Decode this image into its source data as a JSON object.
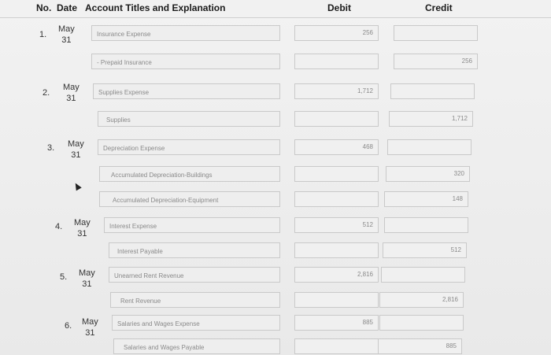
{
  "header": {
    "no": "No.",
    "date": "Date",
    "account": "Account Titles and Explanation",
    "debit": "Debit",
    "credit": "Credit"
  },
  "entries": [
    {
      "no": "1.",
      "month": "May",
      "day": "31",
      "debit_account": "Insurance Expense",
      "credit_account": "Prepaid Insurance",
      "debit_amount": "256",
      "credit_amount": "256"
    },
    {
      "no": "2.",
      "month": "May",
      "day": "31",
      "debit_account": "Supplies Expense",
      "credit_account": "Supplies",
      "debit_amount": "1,712",
      "credit_amount": "1,712"
    },
    {
      "no": "3.",
      "month": "May",
      "day": "31",
      "debit_account": "Depreciation Expense",
      "credit_account": "Accumulated Depreciation-Buildings",
      "credit_account_2": "Accumulated Depreciation-Equipment",
      "debit_amount": "468",
      "credit_amount": "320",
      "credit_amount_2": "148"
    },
    {
      "no": "4.",
      "month": "May",
      "day": "31",
      "debit_account": "Interest Expense",
      "credit_account": "Interest Payable",
      "debit_amount": "512",
      "credit_amount": "512"
    },
    {
      "no": "5.",
      "month": "May",
      "day": "31",
      "debit_account": "Unearned Rent Revenue",
      "credit_account": "Rent Revenue",
      "debit_amount": "2,816",
      "credit_amount": "2,816"
    },
    {
      "no": "6.",
      "month": "May",
      "day": "31",
      "debit_account": "Salaries and Wages Expense",
      "credit_account": "Salaries and Wages Payable",
      "debit_amount": "885",
      "credit_amount": "885"
    }
  ]
}
